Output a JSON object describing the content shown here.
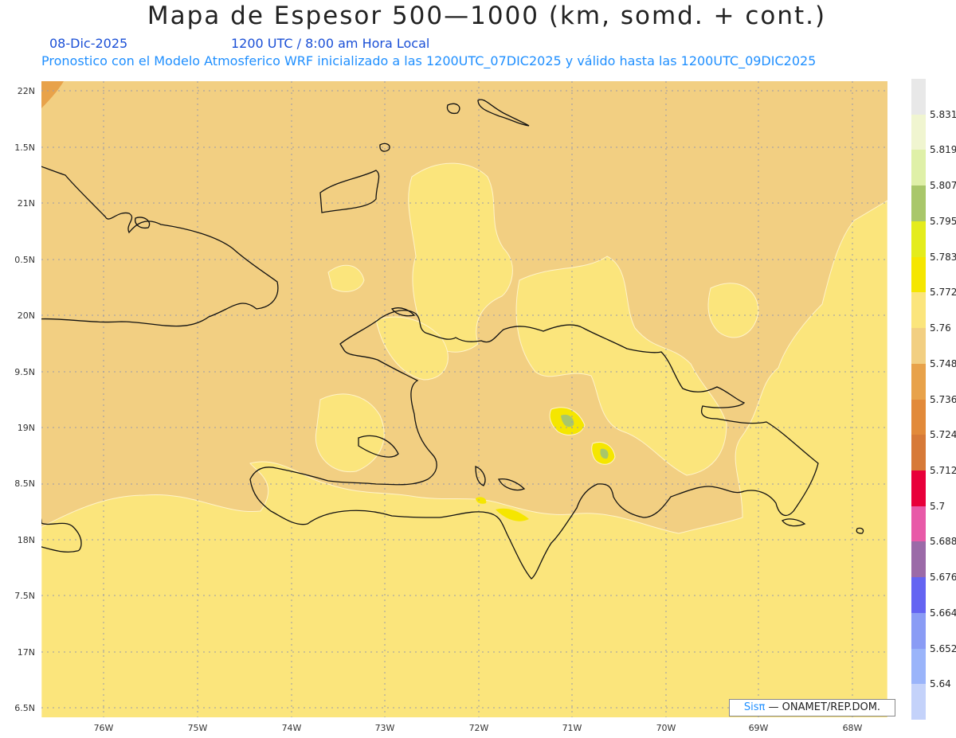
{
  "header": {
    "title": "Mapa de Espesor 500—1000 (km, somd. + cont.)",
    "date": "08-Dic-2025",
    "time": "1200 UTC / 8:00 am Hora Local",
    "forecast_info": "Pronostico con el Modelo Atmosferico WRF inicializado a las 1200UTC_07DIC2025 y válido hasta las  1200UTC_09DIC2025"
  },
  "map": {
    "lat_labels": [
      "22N",
      "1.5N",
      "21N",
      "0.5N",
      "20N",
      "9.5N",
      "19N",
      "8.5N",
      "18N",
      "7.5N",
      "17N",
      "6.5N"
    ],
    "lon_labels": [
      "76W",
      "75W",
      "74W",
      "73W",
      "72W",
      "71W",
      "70W",
      "69W",
      "68W"
    ],
    "fill_colors": {
      "background": "#f2cf82",
      "band_5_76": "#fbe57c",
      "band_5_772": "#f5e600",
      "band_5_795": "#a9c76a",
      "band_5_736": "#e8a24a",
      "contour": "#fff3c8",
      "coastline": "#111111",
      "grid": "#9a9aa8"
    }
  },
  "legend": {
    "labels": [
      "5.831",
      "5.819",
      "5.807",
      "5.795",
      "5.783",
      "5.772",
      "5.76",
      "5.748",
      "5.736",
      "5.724",
      "5.712",
      "5.7",
      "5.688",
      "5.676",
      "5.664",
      "5.652",
      "5.64"
    ],
    "colors": [
      "#e8e8e8",
      "#f0f5d0",
      "#dff0a8",
      "#a9c76a",
      "#e4ec1c",
      "#f5e600",
      "#fbe57c",
      "#f2cf82",
      "#e8a24a",
      "#e28a3a",
      "#d77a38",
      "#e8003a",
      "#e85aa8",
      "#9b6aa8",
      "#6464f2",
      "#8a9cf5",
      "#9ab4fa",
      "#c4d2fa"
    ]
  },
  "credit": {
    "sis": "Sisπ",
    "org": "— ONAMET/REP.DOM."
  }
}
